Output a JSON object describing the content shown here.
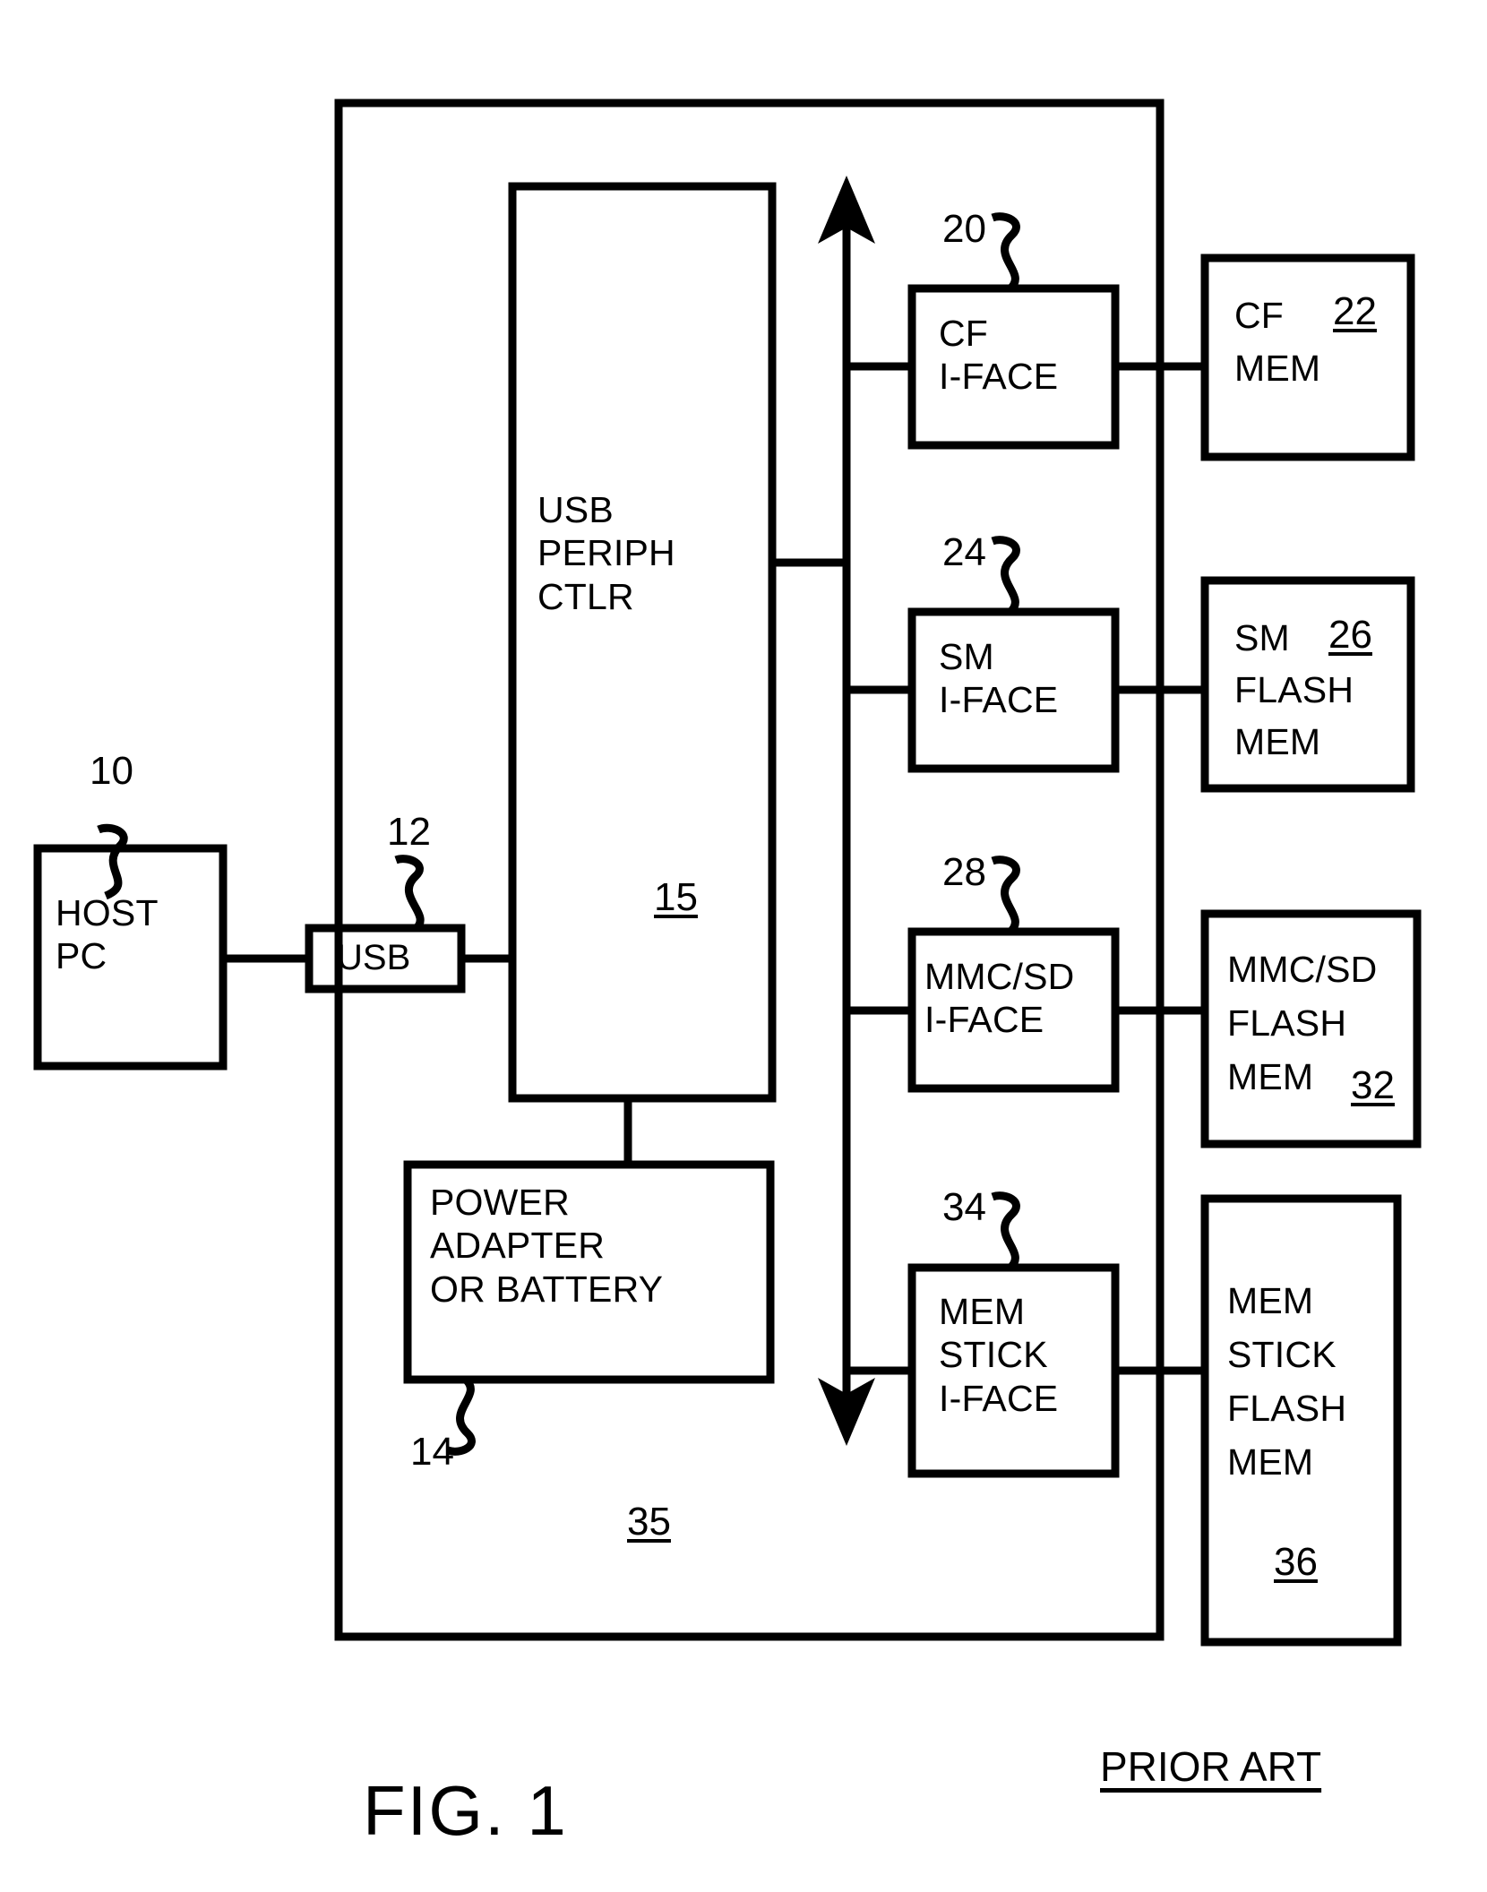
{
  "figure": {
    "title": "FIG. 1",
    "prior_art_note": "PRIOR ART"
  },
  "blocks": {
    "host_pc": {
      "label": "HOST\nPC",
      "ref": "10"
    },
    "usb_connector": {
      "label": "USB",
      "ref": "12"
    },
    "usb_periph_ctlr": {
      "label": "USB\nPERIPH\nCTLR",
      "ref": "15"
    },
    "power_adapter": {
      "label": "POWER\nADAPTER\nOR BATTERY",
      "ref": "14"
    },
    "enclosure": {
      "ref": "35"
    },
    "cf_iface": {
      "label": "CF\nI-FACE",
      "ref": "20"
    },
    "cf_mem": {
      "label_line1": "CF",
      "label_line2": "MEM",
      "ref": "22"
    },
    "sm_iface": {
      "label": "SM\nI-FACE",
      "ref": "24"
    },
    "sm_flash_mem": {
      "label_line1": "SM",
      "label_line2": "FLASH",
      "label_line3": "MEM",
      "ref": "26"
    },
    "mmcsd_iface": {
      "label": "MMC/SD\nI-FACE",
      "ref": "28"
    },
    "mmcsd_flash_mem": {
      "label_line1": "MMC/SD",
      "label_line2": "FLASH",
      "label_line3": "MEM",
      "ref": "32"
    },
    "mem_stick_iface": {
      "label": "MEM\nSTICK\nI-FACE",
      "ref": "34"
    },
    "mem_stick_flash_mem": {
      "label_line1": "MEM",
      "label_line2": "STICK",
      "label_line3": "FLASH",
      "label_line4": "MEM",
      "ref": "36"
    }
  },
  "style": {
    "ink": "#000000",
    "paper": "#ffffff"
  }
}
